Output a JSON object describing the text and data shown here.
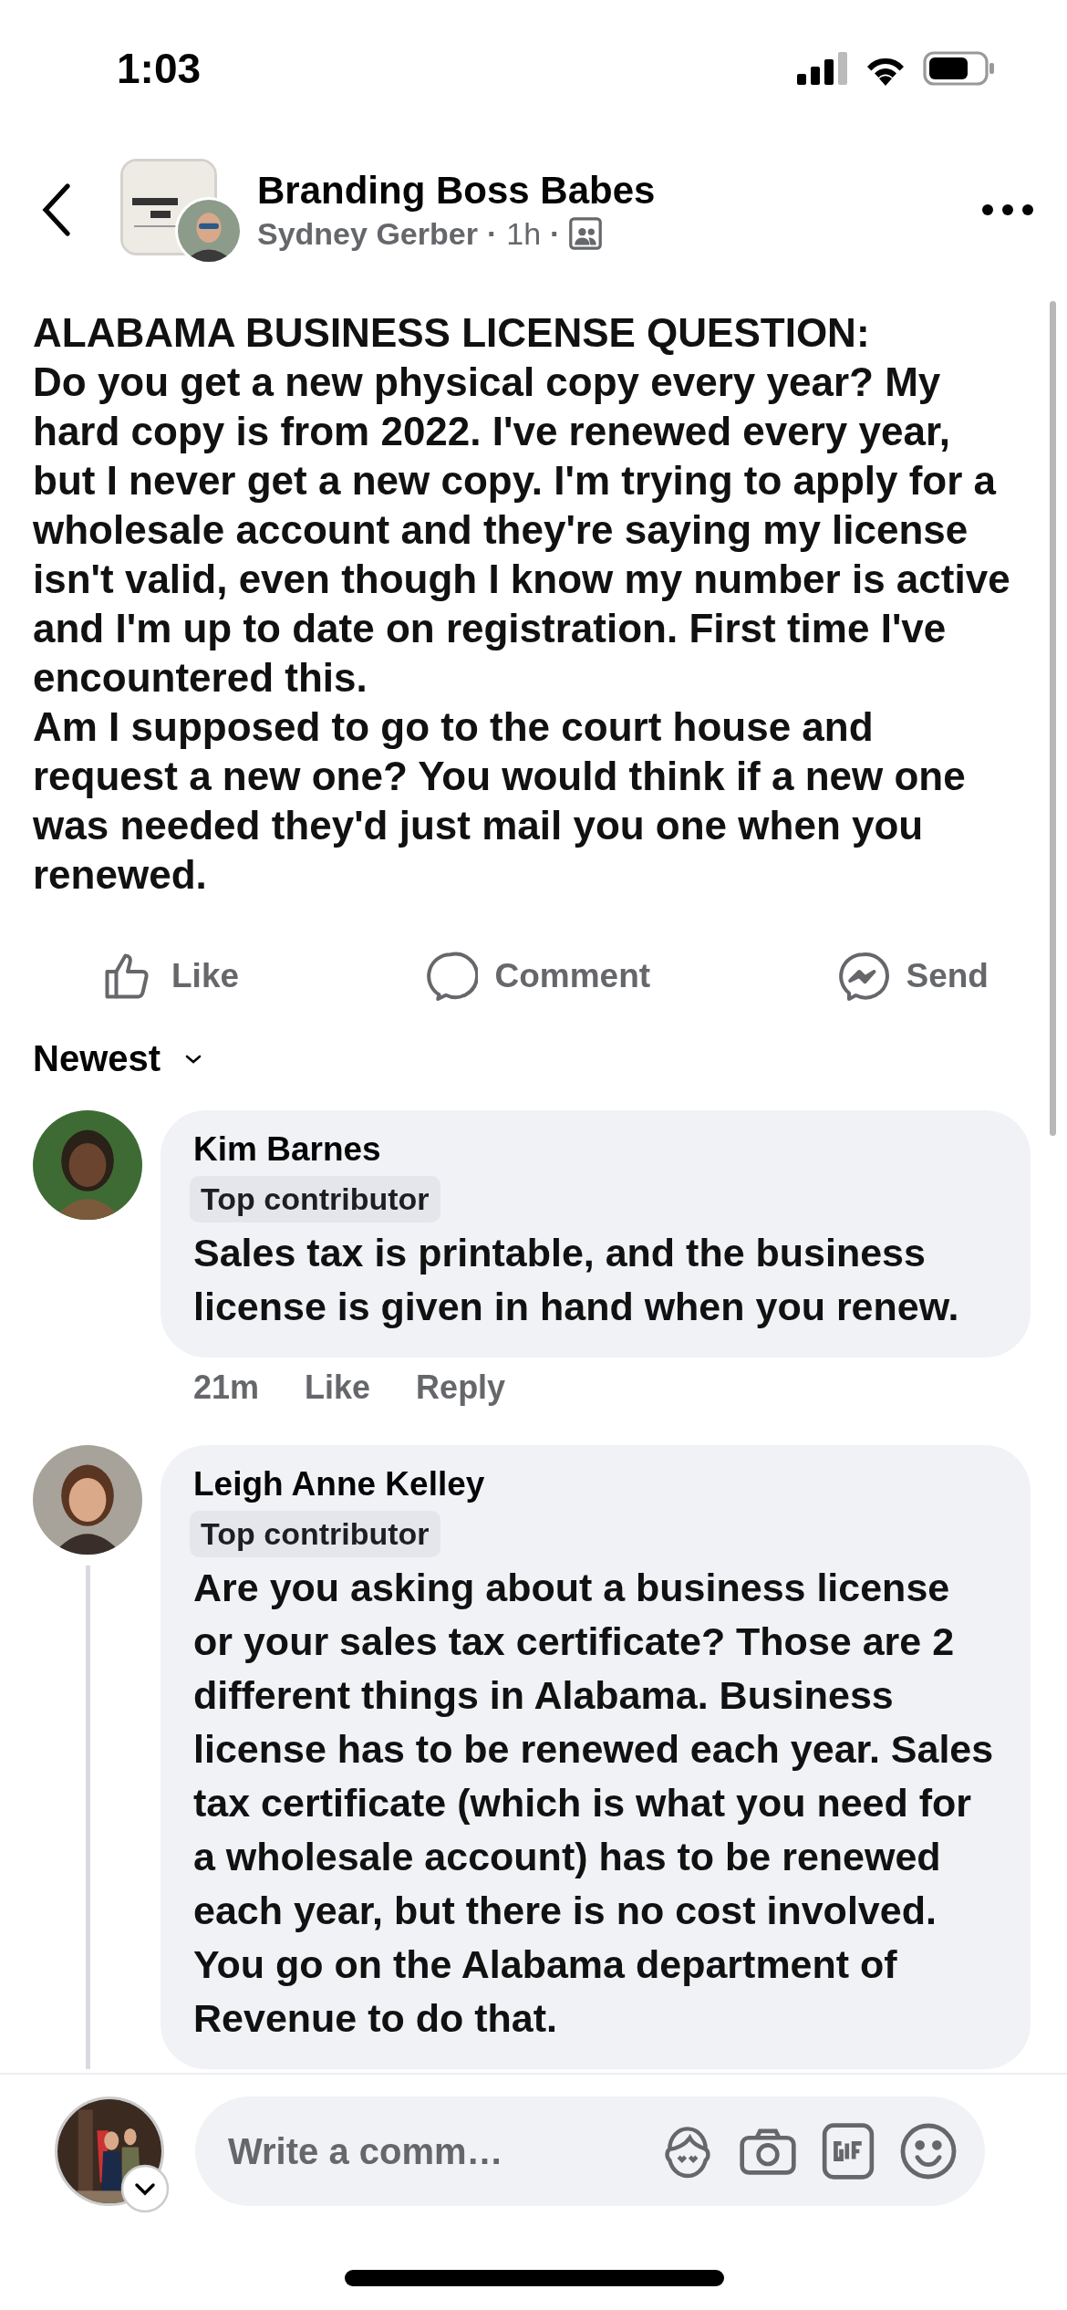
{
  "status_bar": {
    "time": "1:03"
  },
  "header": {
    "group": "Branding Boss Babes",
    "author": "Sydney Gerber",
    "separator_1": "·",
    "time": "1h",
    "separator_2": "·"
  },
  "post": {
    "paragraphs": [
      "ALABAMA BUSINESS LICENSE QUESTION:",
      "Do you get a new physical copy every year? My hard copy is from 2022. I've renewed every year, but I never get a new copy. I'm trying to apply for a wholesale account and they're saying my license isn't valid, even though I know my number is active and I'm up to date on registration. First time I've encountered this.",
      "Am I supposed to go to the court house and request a new one? You would think if a new one was needed they'd just mail you one when you renewed."
    ]
  },
  "actions": [
    {
      "kind": "like",
      "label": "Like"
    },
    {
      "kind": "comment",
      "label": "Comment"
    },
    {
      "kind": "send",
      "label": "Send"
    }
  ],
  "sort": {
    "label": "Newest"
  },
  "comments": [
    {
      "author": "Kim Barnes",
      "badge": "Top contributor",
      "text": "Sales tax is printable, and the business license is given in hand when you renew.",
      "time": "21m",
      "actions": [
        "Like",
        "Reply"
      ],
      "has_replies": false
    },
    {
      "author": "Leigh Anne Kelley",
      "badge": "Top contributor",
      "text": "Are you asking about a business license or your sales tax certificate? Those are 2 different things in Alabama. Business license has to be renewed each year. Sales tax certificate (which is what you need for a wholesale account) has to be renewed each year, but there is no cost involved. You go on the Alabama department of Revenue to do that.",
      "has_replies": true
    }
  ],
  "composer": {
    "placeholder": "Write a comm…"
  }
}
